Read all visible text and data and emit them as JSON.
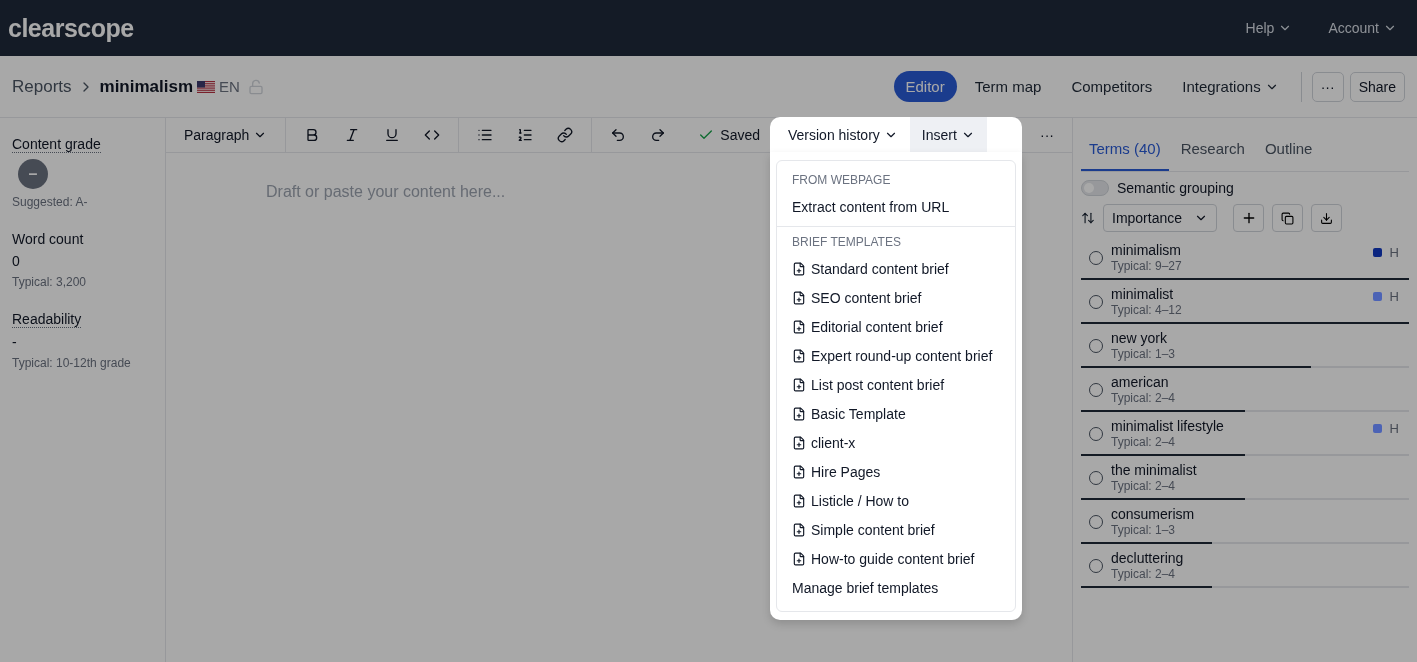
{
  "app": {
    "logo": "clearscope",
    "menus": [
      {
        "label": "Help"
      },
      {
        "label": "Account"
      }
    ]
  },
  "breadcrumb": {
    "parent": "Reports",
    "current": "minimalism",
    "language": "EN"
  },
  "nav_tabs": [
    {
      "label": "Editor",
      "selected": true,
      "dropdown": false
    },
    {
      "label": "Term map",
      "selected": false,
      "dropdown": false
    },
    {
      "label": "Competitors",
      "selected": false,
      "dropdown": false
    },
    {
      "label": "Integrations",
      "selected": false,
      "dropdown": true
    }
  ],
  "nav_buttons": {
    "more": "···",
    "share": "Share"
  },
  "metrics": [
    {
      "kind": "grade",
      "title": "Content grade",
      "value": "–",
      "note": "Suggested: A-"
    },
    {
      "kind": "plain",
      "title": "Word count",
      "value": "0",
      "note": "Typical: 3,200"
    },
    {
      "kind": "underlined",
      "title": "Readability",
      "value": "-",
      "note": "Typical: 10-12th grade"
    }
  ],
  "toolbar": {
    "block_style": "Paragraph",
    "status": "Saved",
    "version_history": "Version history",
    "insert": "Insert",
    "more": "···"
  },
  "editor": {
    "placeholder": "Draft or paste your content here..."
  },
  "insert_menu": [
    {
      "heading": "FROM WEBPAGE",
      "items": [
        {
          "kind": "action",
          "label": "Extract content from URL"
        }
      ]
    },
    {
      "heading": "BRIEF TEMPLATES",
      "items": [
        {
          "kind": "template",
          "label": "Standard content brief"
        },
        {
          "kind": "template",
          "label": "SEO content brief"
        },
        {
          "kind": "template",
          "label": "Editorial content brief"
        },
        {
          "kind": "template",
          "label": "Expert round-up content brief"
        },
        {
          "kind": "template",
          "label": "List post content brief"
        },
        {
          "kind": "template",
          "label": "Basic Template"
        },
        {
          "kind": "template",
          "label": "client-x"
        },
        {
          "kind": "template",
          "label": "Hire Pages"
        },
        {
          "kind": "template",
          "label": "Listicle / How to"
        },
        {
          "kind": "template",
          "label": "Simple content brief"
        },
        {
          "kind": "template",
          "label": "How-to guide content brief"
        },
        {
          "kind": "action",
          "label": "Manage brief templates"
        }
      ]
    }
  ],
  "panel_tabs": [
    {
      "label": "Terms (40)",
      "selected": true
    },
    {
      "label": "Research",
      "selected": false
    },
    {
      "label": "Outline",
      "selected": false
    }
  ],
  "semantic_grouping": {
    "label": "Semantic grouping",
    "on": false
  },
  "sort": {
    "label": "Importance"
  },
  "terms": [
    {
      "name": "minimalism",
      "typical": "Typical: 9–27",
      "checked": false,
      "level": 1,
      "badge": "H",
      "color": "#0b2580"
    },
    {
      "name": "minimalist",
      "typical": "Typical: 4–12",
      "checked": false,
      "level": 1,
      "badge": "H",
      "color": "#4c63b5"
    },
    {
      "name": "new york",
      "typical": "Typical: 1–3",
      "checked": false,
      "level": 0.7
    },
    {
      "name": "american",
      "typical": "Typical: 2–4",
      "checked": false,
      "level": 0.5
    },
    {
      "name": "minimalist lifestyle",
      "typical": "Typical: 2–4",
      "checked": false,
      "level": 0.5,
      "badge": "H",
      "color": "#4c63b5"
    },
    {
      "name": "the minimalist",
      "typical": "Typical: 2–4",
      "checked": false,
      "level": 0.5
    },
    {
      "name": "consumerism",
      "typical": "Typical: 1–3",
      "checked": false,
      "level": 0.4
    },
    {
      "name": "decluttering",
      "typical": "Typical: 2–4",
      "checked": false,
      "level": 0.4
    }
  ]
}
